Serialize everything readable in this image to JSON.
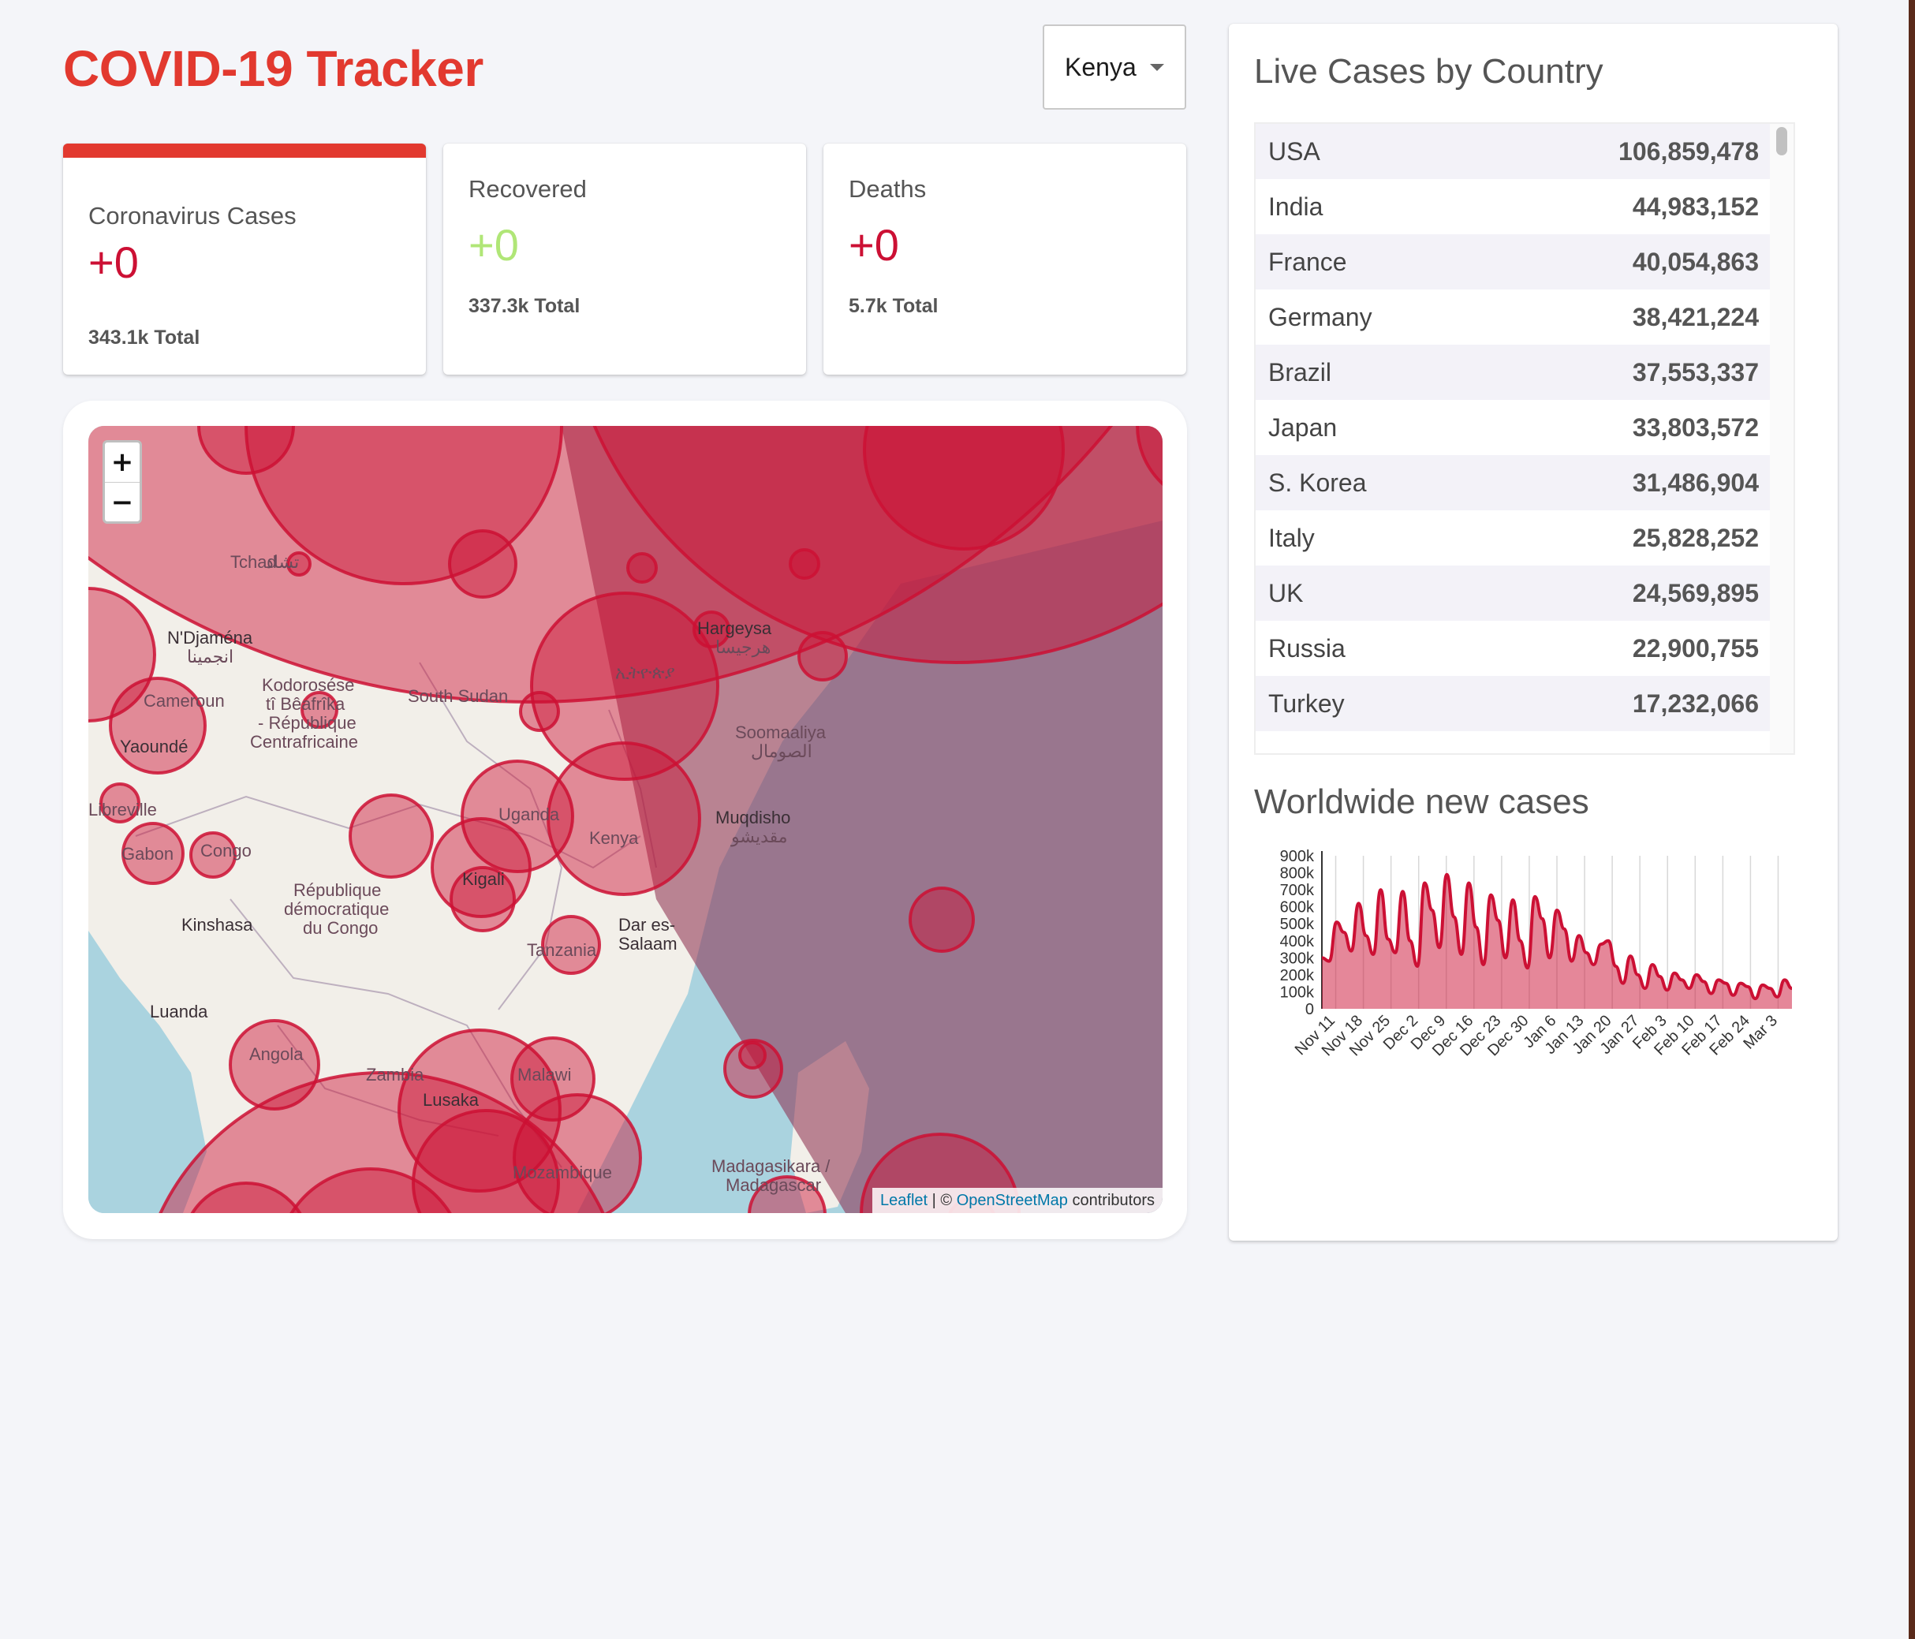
{
  "app": {
    "title": "COVID-19 Tracker"
  },
  "country_select": {
    "value": "Kenya"
  },
  "stats": [
    {
      "title": "Coronavirus Cases",
      "value": "+0",
      "total": "343.1k Total"
    },
    {
      "title": "Recovered",
      "value": "+0",
      "total": "337.3k Total"
    },
    {
      "title": "Deaths",
      "value": "+0",
      "total": "5.7k Total"
    }
  ],
  "map": {
    "labels": [
      "Tchad",
      "تشاد",
      "N'Djaména",
      "انجمينا",
      "Kodorosése",
      "tî Bêafrîka",
      "- République",
      "Centrafricaine",
      "Cameroun",
      "Yaoundé",
      "South Sudan",
      "Soomaaliya",
      "الصومال",
      "Muqdisho",
      "مقديشو",
      "Uganda",
      "Kenya",
      "Kigali",
      "République",
      "démocratique",
      "du Congo",
      "Gabon",
      "Congo",
      "Kinshasa",
      "Luanda",
      "Angola",
      "Zambia",
      "Lusaka",
      "Malawi",
      "Tanzania",
      "Dar es-",
      "Salaam",
      "Mozambique",
      "Madagasikara /",
      "Madagascar",
      "Hargeysa",
      "هرجيسا",
      "ኢትዮጵያ",
      "Libreville"
    ],
    "zoom_in": "+",
    "zoom_out": "−",
    "attribution": {
      "leaflet": "Leaflet",
      "separator": "| ©",
      "osm": "OpenStreetMap",
      "suffix": "contributors"
    }
  },
  "live_cases": {
    "heading": "Live Cases by Country",
    "rows": [
      {
        "country": "USA",
        "cases": "106,859,478"
      },
      {
        "country": "India",
        "cases": "44,983,152"
      },
      {
        "country": "France",
        "cases": "40,054,863"
      },
      {
        "country": "Germany",
        "cases": "38,421,224"
      },
      {
        "country": "Brazil",
        "cases": "37,553,337"
      },
      {
        "country": "Japan",
        "cases": "33,803,572"
      },
      {
        "country": "S. Korea",
        "cases": "31,486,904"
      },
      {
        "country": "Italy",
        "cases": "25,828,252"
      },
      {
        "country": "UK",
        "cases": "24,569,895"
      },
      {
        "country": "Russia",
        "cases": "22,900,755"
      },
      {
        "country": "Turkey",
        "cases": "17,232,066"
      }
    ]
  },
  "worldwide": {
    "heading": "Worldwide new cases",
    "chart_data": {
      "type": "area",
      "title": "Worldwide new cases",
      "ylim": [
        0,
        900000
      ],
      "y_ticks": [
        "900k",
        "800k",
        "700k",
        "600k",
        "500k",
        "400k",
        "300k",
        "200k",
        "100k",
        "0"
      ],
      "x_ticks": [
        "Nov 11",
        "Nov 18",
        "Nov 25",
        "Dec 2",
        "Dec 9",
        "Dec 16",
        "Dec 23",
        "Dec 30",
        "Jan 6",
        "Jan 13",
        "Jan 20",
        "Jan 27",
        "Feb 3",
        "Feb 10",
        "Feb 17",
        "Feb 24",
        "Mar 3"
      ],
      "values": [
        300000,
        280000,
        510000,
        450000,
        340000,
        620000,
        430000,
        320000,
        700000,
        410000,
        330000,
        690000,
        400000,
        250000,
        740000,
        580000,
        360000,
        790000,
        540000,
        320000,
        740000,
        480000,
        260000,
        670000,
        520000,
        300000,
        640000,
        400000,
        240000,
        660000,
        530000,
        300000,
        580000,
        470000,
        280000,
        430000,
        330000,
        260000,
        380000,
        400000,
        250000,
        150000,
        310000,
        200000,
        120000,
        260000,
        190000,
        110000,
        210000,
        170000,
        120000,
        200000,
        160000,
        90000,
        170000,
        150000,
        80000,
        150000,
        130000,
        60000,
        140000,
        120000,
        70000,
        170000,
        120000
      ],
      "color": "#cc1034"
    }
  },
  "colors": {
    "accent": "#e2392f",
    "cases": "#cc1034",
    "recovered": "#7dd71d"
  }
}
